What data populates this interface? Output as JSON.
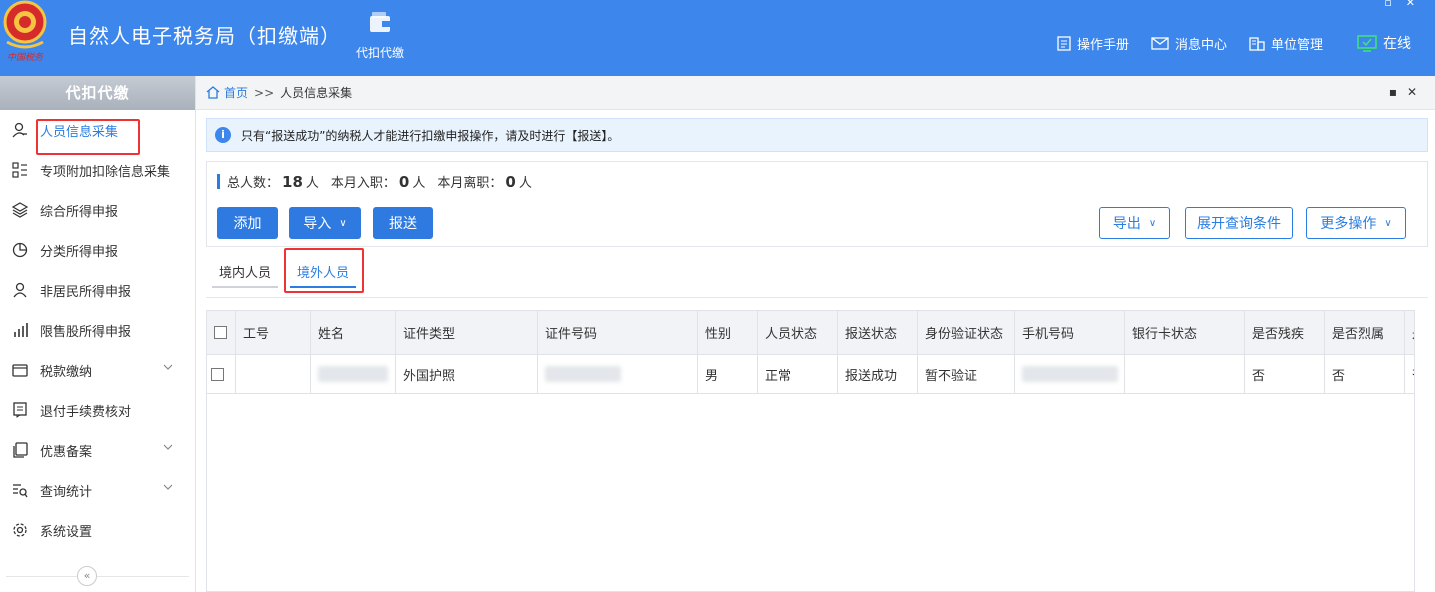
{
  "header": {
    "app_title": "自然人电子税务局（扣缴端）",
    "logo_caption": "中国税务",
    "module": {
      "label": "代扣代缴",
      "icon": "wallet-icon"
    },
    "links": [
      {
        "label": "操作手册",
        "icon": "manual-icon"
      },
      {
        "label": "消息中心",
        "icon": "mail-icon"
      },
      {
        "label": "单位管理",
        "icon": "building-icon"
      }
    ],
    "status": {
      "label": "在线",
      "icon": "monitor-icon",
      "color": "#3fe07a"
    },
    "accent": "#3c86ec"
  },
  "sidebar": {
    "title": "代扣代缴",
    "items": [
      {
        "label": "人员信息采集",
        "icon": "user-icon",
        "active": true
      },
      {
        "label": "专项附加扣除信息采集",
        "icon": "list-icon"
      },
      {
        "label": "综合所得申报",
        "icon": "layers-icon"
      },
      {
        "label": "分类所得申报",
        "icon": "pie-icon"
      },
      {
        "label": "非居民所得申报",
        "icon": "person-icon"
      },
      {
        "label": "限售股所得申报",
        "icon": "bar-chart-icon"
      },
      {
        "label": "税款缴纳",
        "icon": "wallet-icon",
        "expandable": true
      },
      {
        "label": "退付手续费核对",
        "icon": "document-icon"
      },
      {
        "label": "优惠备案",
        "icon": "copy-icon",
        "expandable": true
      },
      {
        "label": "查询统计",
        "icon": "search-list-icon",
        "expandable": true
      },
      {
        "label": "系统设置",
        "icon": "gear-icon"
      }
    ],
    "collapse_glyph": "«"
  },
  "breadcrumb": {
    "home": "首页",
    "separator": ">>",
    "current": "人员信息采集"
  },
  "notice": {
    "text": "只有“报送成功”的纳税人才能进行扣缴申报操作，请及时进行【报送】。"
  },
  "stats": {
    "total_label": "总人数：",
    "total_value": "18",
    "total_unit": "人",
    "joined_label": "本月入职：",
    "joined_value": "0",
    "joined_unit": "人",
    "left_label": "本月离职：",
    "left_value": "0",
    "left_unit": "人"
  },
  "toolbar": {
    "add": "添加",
    "import": "导入",
    "submit": "报送",
    "export": "导出",
    "expand_query": "展开查询条件",
    "more": "更多操作"
  },
  "tabs": [
    {
      "label": "境内人员"
    },
    {
      "label": "境外人员",
      "active": true
    }
  ],
  "table": {
    "columns": [
      "工号",
      "姓名",
      "证件类型",
      "证件号码",
      "性别",
      "人员状态",
      "报送状态",
      "身份验证状态",
      "手机号码",
      "银行卡状态",
      "是否残疾",
      "是否烈属",
      "是"
    ],
    "rows": [
      [
        "",
        "",
        "外国护照",
        "",
        "男",
        "正常",
        "报送成功",
        "暂不验证",
        "",
        "",
        "否",
        "否",
        "否"
      ]
    ]
  }
}
